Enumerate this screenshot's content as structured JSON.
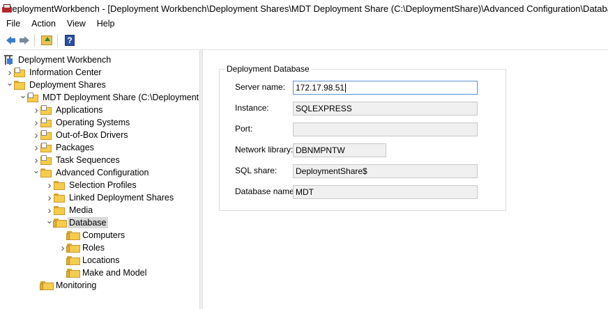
{
  "window": {
    "title": "DeploymentWorkbench - [Deployment Workbench\\Deployment Shares\\MDT Deployment Share (C:\\DeploymentShare)\\Advanced Configuration\\Database]"
  },
  "menu": [
    "File",
    "Action",
    "View",
    "Help"
  ],
  "toolbar": {
    "back_icon": "back-arrow-icon",
    "forward_icon": "forward-arrow-icon",
    "up_icon": "up-folder-icon",
    "help_icon": "help-icon",
    "help_glyph": "?"
  },
  "tree": {
    "root": "Deployment Workbench",
    "items": [
      {
        "label": "Information Center",
        "indent": 1,
        "expander": ">",
        "icon": "info-folder"
      },
      {
        "label": "Deployment Shares",
        "indent": 1,
        "expander": "v",
        "icon": "folder"
      },
      {
        "label": "MDT Deployment Share (C:\\DeploymentShare)",
        "indent": 2,
        "expander": "v",
        "icon": "share-folder"
      },
      {
        "label": "Applications",
        "indent": 3,
        "expander": ">",
        "icon": "apps-folder"
      },
      {
        "label": "Operating Systems",
        "indent": 3,
        "expander": ">",
        "icon": "os-folder"
      },
      {
        "label": "Out-of-Box Drivers",
        "indent": 3,
        "expander": ">",
        "icon": "drivers-folder"
      },
      {
        "label": "Packages",
        "indent": 3,
        "expander": ">",
        "icon": "packages-folder"
      },
      {
        "label": "Task Sequences",
        "indent": 3,
        "expander": ">",
        "icon": "tasks-folder"
      },
      {
        "label": "Advanced Configuration",
        "indent": 3,
        "expander": "v",
        "icon": "folder"
      },
      {
        "label": "Selection Profiles",
        "indent": 4,
        "expander": ">",
        "icon": "folder"
      },
      {
        "label": "Linked Deployment Shares",
        "indent": 4,
        "expander": ">",
        "icon": "folder"
      },
      {
        "label": "Media",
        "indent": 4,
        "expander": ">",
        "icon": "folder"
      },
      {
        "label": "Database",
        "indent": 4,
        "expander": "v",
        "icon": "db-folder",
        "selected": true
      },
      {
        "label": "Computers",
        "indent": 5,
        "expander": "",
        "icon": "db-folder"
      },
      {
        "label": "Roles",
        "indent": 5,
        "expander": ">",
        "icon": "db-folder"
      },
      {
        "label": "Locations",
        "indent": 5,
        "expander": "",
        "icon": "db-folder"
      },
      {
        "label": "Make and Model",
        "indent": 5,
        "expander": "",
        "icon": "db-folder"
      },
      {
        "label": "Monitoring",
        "indent": 3,
        "expander": "",
        "icon": "db-folder"
      }
    ]
  },
  "database_panel": {
    "group_title": "Deployment Database",
    "fields": [
      {
        "label": "Server name:",
        "value": "172.17.98.51",
        "active": true
      },
      {
        "label": "Instance:",
        "value": "SQLEXPRESS"
      },
      {
        "label": "Port:",
        "value": ""
      },
      {
        "label": "Network library:",
        "value": "DBNMPNTW"
      },
      {
        "label": "SQL share:",
        "value": "DeploymentShare$"
      },
      {
        "label": "Database name:",
        "value": "MDT"
      }
    ]
  }
}
